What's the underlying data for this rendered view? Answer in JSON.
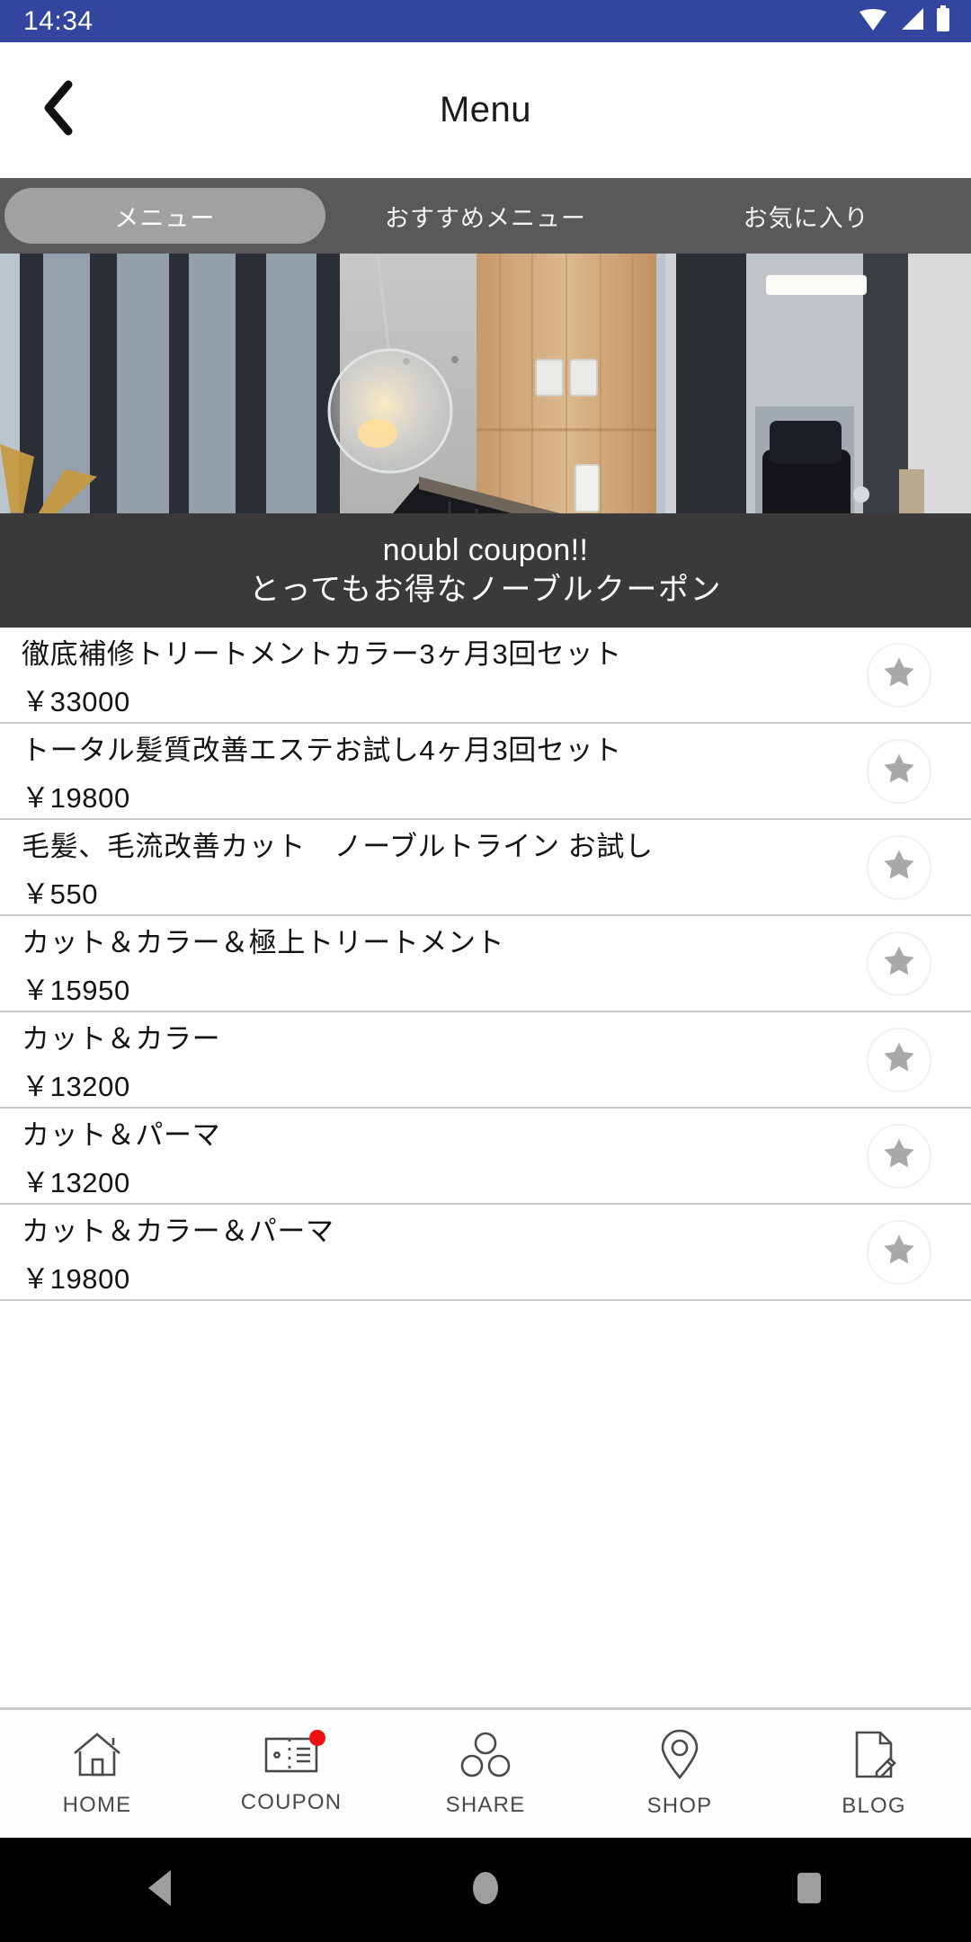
{
  "status_bar": {
    "time": "14:34",
    "icons": [
      "wifi-icon",
      "cellular-signal-icon",
      "battery-icon"
    ],
    "background": "#32469F",
    "foreground": "#FFFFFF"
  },
  "app_bar": {
    "back_icon": "back-chevron-icon",
    "title": "Menu"
  },
  "tabs": {
    "active_index": 0,
    "items": [
      {
        "label": "メニュー"
      },
      {
        "label": "おすすめメニュー"
      },
      {
        "label": "お気に入り"
      }
    ],
    "background": "#5B585B",
    "active_pill": "#A3A0A3"
  },
  "hero": {
    "alt": "salon interior with windows, gold starburst mirror, glass pendant lamp and styling chair",
    "caption_line1": "noubl coupon!!",
    "caption_line2": "とってもお得なノーブルクーポン",
    "caption_background": "#3A3A3A"
  },
  "menu_items": [
    {
      "name": "徹底補修トリートメントカラー3ヶ月3回セット",
      "price": "￥33000",
      "favorite_icon": "star-icon"
    },
    {
      "name": "トータル髪質改善エステお試し4ヶ月3回セット",
      "price": "￥19800",
      "favorite_icon": "star-icon"
    },
    {
      "name": "毛髪、毛流改善カット　ノーブルトライン お試し",
      "price": "￥550",
      "favorite_icon": "star-icon"
    },
    {
      "name": "カット＆カラー＆極上トリートメント",
      "price": "￥15950",
      "favorite_icon": "star-icon"
    },
    {
      "name": "カット＆カラー",
      "price": "￥13200",
      "favorite_icon": "star-icon"
    },
    {
      "name": "カット＆パーマ",
      "price": "￥13200",
      "favorite_icon": "star-icon"
    },
    {
      "name": "カット＆カラー＆パーマ",
      "price": "￥19800",
      "favorite_icon": "star-icon"
    }
  ],
  "bottom_nav": {
    "items": [
      {
        "label": "HOME",
        "icon": "home-icon",
        "badge": false
      },
      {
        "label": "COUPON",
        "icon": "ticket-icon",
        "badge": true
      },
      {
        "label": "SHARE",
        "icon": "share-icon",
        "badge": false
      },
      {
        "label": "SHOP",
        "icon": "map-pin-icon",
        "badge": false
      },
      {
        "label": "BLOG",
        "icon": "document-pencil-icon",
        "badge": false
      }
    ],
    "badge_color": "#EE1111"
  },
  "system_bar": {
    "buttons": [
      "back-triangle-icon",
      "home-circle-icon",
      "recents-square-icon"
    ],
    "background": "#000000",
    "icon_color": "#9E9E9E"
  }
}
